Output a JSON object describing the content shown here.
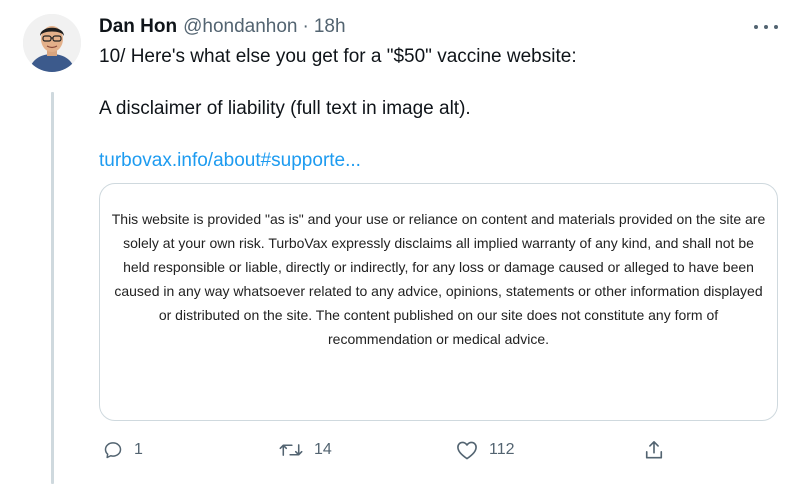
{
  "tweet": {
    "author_name": "Dan Hon",
    "author_handle": "@hondanhon",
    "separator": "·",
    "timestamp": "18h",
    "line1": "10/ Here's what else you get for a \"$50\" vaccine website:",
    "line2": "A disclaimer of liability (full text in image alt).",
    "link": "turbovax.info/about#supporte..."
  },
  "media": {
    "disclaimer_text": "This website is provided \"as is\" and your use or reliance on content and materials provided on the site are solely at your own risk. TurboVax expressly disclaims all implied warranty of any kind, and shall not be held responsible or liable, directly or indirectly, for any loss or damage caused or alleged to have been caused in any way whatsoever related to any advice, opinions, statements or other information displayed or distributed on the site. The content published on our site does not constitute any form of recommendation or medical advice."
  },
  "actions": {
    "reply_count": "1",
    "retweet_count": "14",
    "like_count": "112"
  },
  "icons": {
    "reply": "reply-icon",
    "retweet": "retweet-icon",
    "like": "heart-icon",
    "share": "share-icon",
    "more": "more-options-icon"
  },
  "colors": {
    "link": "#1d9bf0",
    "secondary_text": "#536471",
    "border": "#cfd9de"
  }
}
